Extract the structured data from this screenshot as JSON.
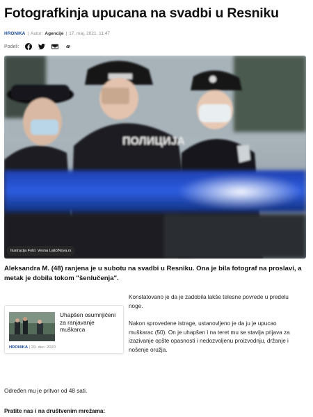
{
  "article": {
    "headline": "Fotografkinja upucana na svadbi u Resniku",
    "category": "HRONIKA",
    "author_label": "Autor:",
    "author": "Agencije",
    "date": "17. maj, 2021. 11:47",
    "share_label": "Podeli:",
    "share_icons": [
      "facebook-icon",
      "twitter-icon",
      "email-icon",
      "link-icon"
    ],
    "image_credit": "Ilustracija Foto: Vesna Lalić/Nova.rs",
    "lead": "Aleksandra M. (48) ranjena je u subotu na svadbi u Resniku. Ona je bila fotograf na proslavi, a metak je dobila tokom \"šenlučenja\".",
    "paragraphs": [
      "Konstatovano je da je zadobila lakše telesne povrede u predelu noge.",
      "Nakon sprovedene istrage, ustanovljeno je da ju je upucao muškarac (50). On je uhapšen i na teret mu se stavlja prijava za izazivanje opšte opasnosti i nedozvoljenu proizvodnju, držanje i nošenje oružja."
    ],
    "detention": "Određen mu je pritvor od 48 sati.",
    "follow": "Pratite nas i na društvenim mrežama:"
  },
  "related": {
    "title": "Uhapšen osumnjičeni za ranjavanje muškarca",
    "category": "HRONIKA",
    "date": "29. dec. 2020"
  },
  "colors": {
    "accent": "#1b4a9a"
  }
}
